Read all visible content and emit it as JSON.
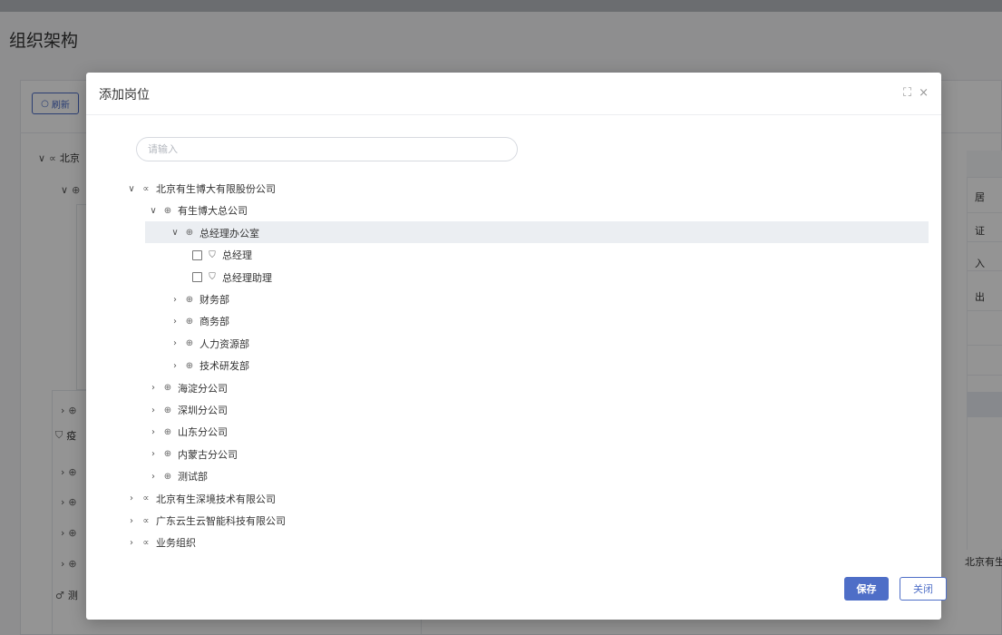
{
  "page": {
    "title": "组织架构",
    "refresh_label": "刷新",
    "refresh_icon": "refresh-icon",
    "bg_tree": [
      {
        "arrow": "∨",
        "icon": "∝",
        "label": "北京"
      },
      {
        "arrow": "∨",
        "icon": "⊕",
        "label": ""
      },
      {
        "arrow": "›",
        "icon": "⊕",
        "label": ""
      },
      {
        "arrow": "",
        "icon": "⛉",
        "label": "疫"
      },
      {
        "arrow": "›",
        "icon": "⊕",
        "label": ""
      },
      {
        "arrow": "›",
        "icon": "⊕",
        "label": ""
      },
      {
        "arrow": "›",
        "icon": "⊕",
        "label": ""
      },
      {
        "arrow": "›",
        "icon": "⊕",
        "label": ""
      },
      {
        "arrow": "",
        "icon": "♂",
        "label": "测"
      }
    ],
    "right_labels": [
      "居",
      "证",
      "入",
      "出"
    ],
    "right_footer_text": "北京有生"
  },
  "modal": {
    "title": "添加岗位",
    "tools": {
      "maximize": "⛶",
      "close": "×"
    },
    "search": {
      "placeholder": "请输入",
      "value": ""
    },
    "tree": [
      {
        "level": 0,
        "arrow": "∨",
        "icon": "∝",
        "label": "北京有生博大有限股份公司"
      },
      {
        "level": 1,
        "arrow": "∨",
        "icon": "⊕",
        "label": "有生博大总公司"
      },
      {
        "level": 2,
        "arrow": "∨",
        "icon": "⊕",
        "label": "总经理办公室",
        "selected": true
      },
      {
        "level": 3,
        "checkbox": true,
        "icon": "⛉",
        "label": "总经理"
      },
      {
        "level": 3,
        "checkbox": true,
        "icon": "⛉",
        "label": "总经理助理"
      },
      {
        "level": 2,
        "arrow": "›",
        "icon": "⊕",
        "label": "财务部"
      },
      {
        "level": 2,
        "arrow": "›",
        "icon": "⊕",
        "label": "商务部"
      },
      {
        "level": 2,
        "arrow": "›",
        "icon": "⊕",
        "label": "人力资源部"
      },
      {
        "level": 2,
        "arrow": "›",
        "icon": "⊕",
        "label": "技术研发部"
      },
      {
        "level": 1,
        "arrow": "›",
        "icon": "⊕",
        "label": "海淀分公司"
      },
      {
        "level": 1,
        "arrow": "›",
        "icon": "⊕",
        "label": "深圳分公司"
      },
      {
        "level": 1,
        "arrow": "›",
        "icon": "⊕",
        "label": "山东分公司"
      },
      {
        "level": 1,
        "arrow": "›",
        "icon": "⊕",
        "label": "内蒙古分公司"
      },
      {
        "level": 1,
        "arrow": "›",
        "icon": "⊕",
        "label": "测试部"
      },
      {
        "level": 0,
        "arrow": "›",
        "icon": "∝",
        "label": "北京有生深境技术有限公司"
      },
      {
        "level": 0,
        "arrow": "›",
        "icon": "∝",
        "label": "广东云生云智能科技有限公司"
      },
      {
        "level": 0,
        "arrow": "›",
        "icon": "∝",
        "label": "业务组织"
      }
    ],
    "footer": {
      "save_label": "保存",
      "close_label": "关闭"
    }
  },
  "colors": {
    "primary": "#4e6ec7",
    "selected_row": "#ebeef2"
  }
}
